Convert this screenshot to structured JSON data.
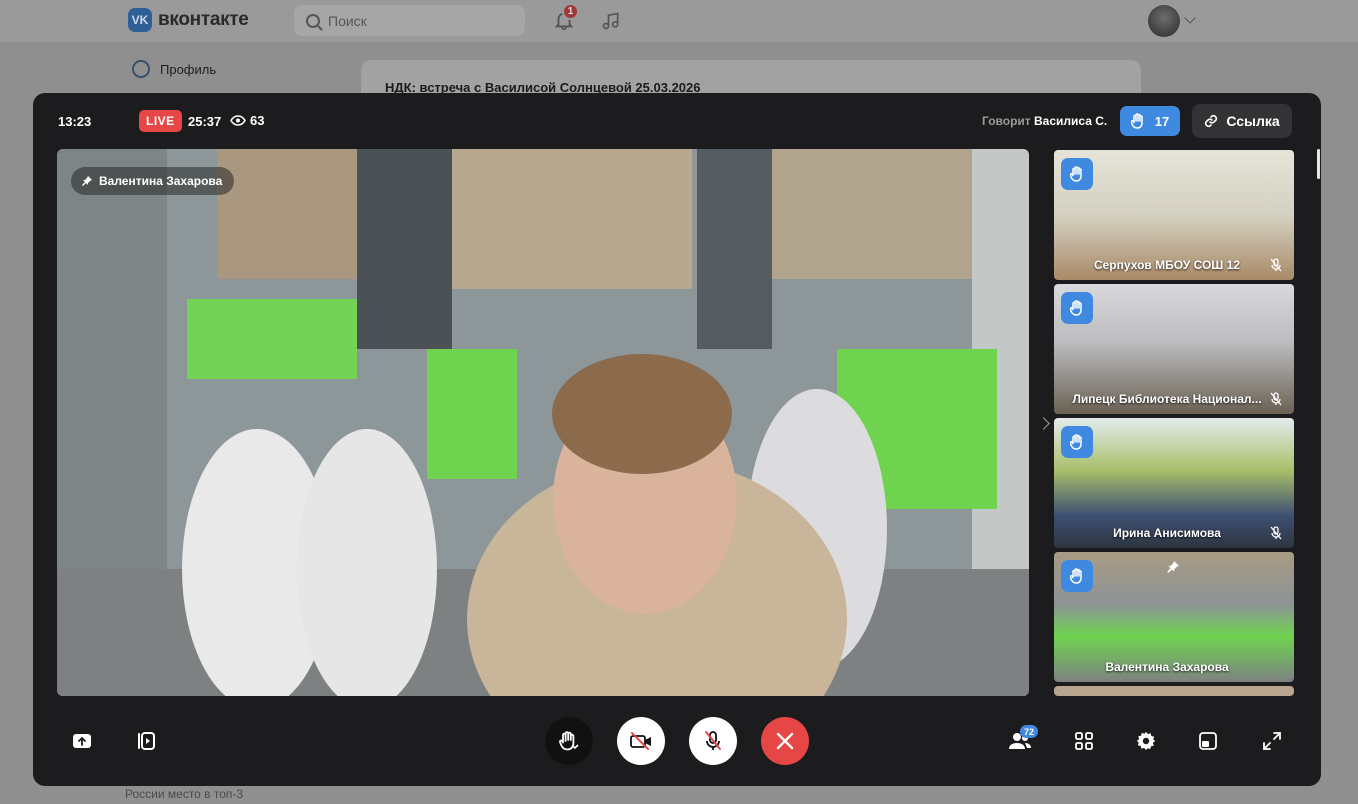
{
  "vk": {
    "logo_glyph": "VK",
    "logo_text": "вконтакте",
    "search_placeholder": "Поиск",
    "notifications_count": "1",
    "sidebar_profile": "Профиль",
    "post_title": "НДК: встреча с Василисой Солнцевой 25.03.2026",
    "bottom_text": "России место в топ-3"
  },
  "call": {
    "clock": "13:23",
    "live_label": "LIVE",
    "duration": "25:37",
    "viewers": "63",
    "speaking_prefix": "Говорит",
    "speaking_name": "Василиса С.",
    "raised_hands": "17",
    "link_label": "Ссылка",
    "pinned_name": "Валентина Захарова",
    "participants_count": "72",
    "tiles": [
      {
        "name": "Серпухов МБОУ СОШ 12"
      },
      {
        "name": "Липецк Библиотека Национал..."
      },
      {
        "name": "Ирина Анисимова"
      },
      {
        "name": "Валентина Захарова"
      }
    ]
  },
  "colors": {
    "accent_blue": "#3f8ae0",
    "live_red": "#e64646",
    "end_call_red": "#e64646",
    "window_bg": "#1c1c1e"
  },
  "icons": {
    "upload": "share-screen-icon",
    "record": "record-icon",
    "hand": "raise-hand-icon",
    "camera_off": "camera-off-icon",
    "mic_off": "mic-off-icon",
    "hang_up": "hang-up-icon",
    "participants": "participants-icon",
    "grid": "grid-icon",
    "settings": "gear-icon",
    "pip": "picture-in-picture-icon",
    "fullscreen": "fullscreen-icon"
  }
}
